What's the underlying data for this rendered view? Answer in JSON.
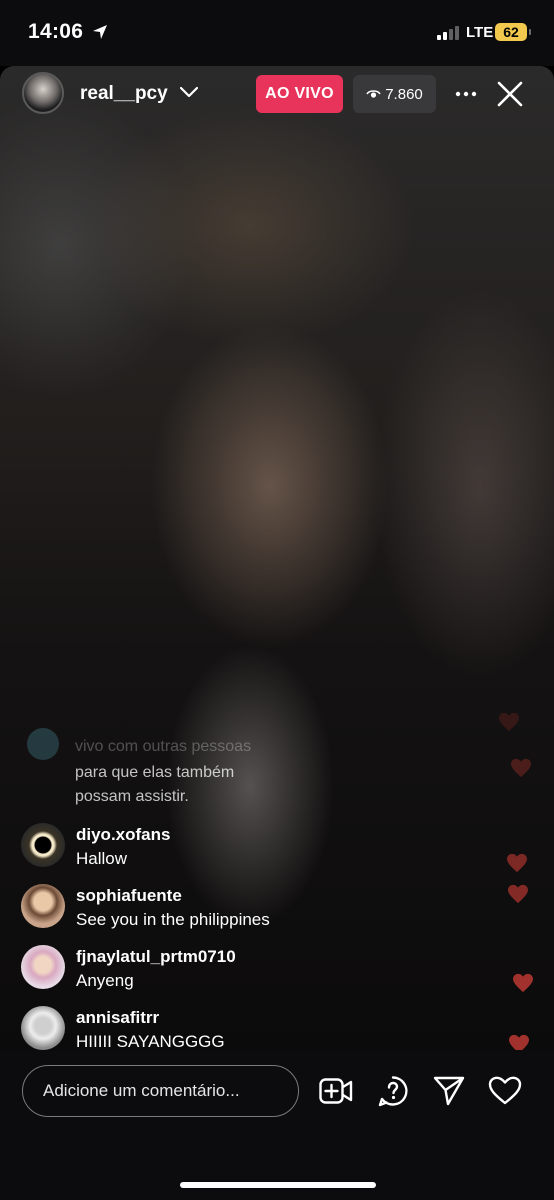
{
  "status_bar": {
    "time": "14:06",
    "network": "LTE",
    "battery": "62"
  },
  "live": {
    "host_username": "real__pcy",
    "live_badge": "AO VIVO",
    "viewer_count": "7.860"
  },
  "system_message": {
    "line1": "vivo com outras pessoas",
    "line2": "para que elas também",
    "line3": "possam assistir."
  },
  "comments": [
    {
      "username": "diyo.xofans",
      "text": "Hallow"
    },
    {
      "username": "sophiafuente",
      "text": "See you in the philippines"
    },
    {
      "username": "fjnaylatul_prtm0710",
      "text": "Anyeng"
    },
    {
      "username": "annisafitrr",
      "text": "HIIIII SAYANGGGG"
    }
  ],
  "comment_box": {
    "placeholder": "Adicione um comentário..."
  },
  "colors": {
    "live_badge": "#e8345a",
    "battery": "#f2c94c",
    "heart": "#a0312c"
  },
  "icons": [
    "location-arrow-icon",
    "chevron-down-icon",
    "eye-icon",
    "more-icon",
    "close-icon",
    "add-video-icon",
    "question-icon",
    "send-icon",
    "heart-icon"
  ]
}
